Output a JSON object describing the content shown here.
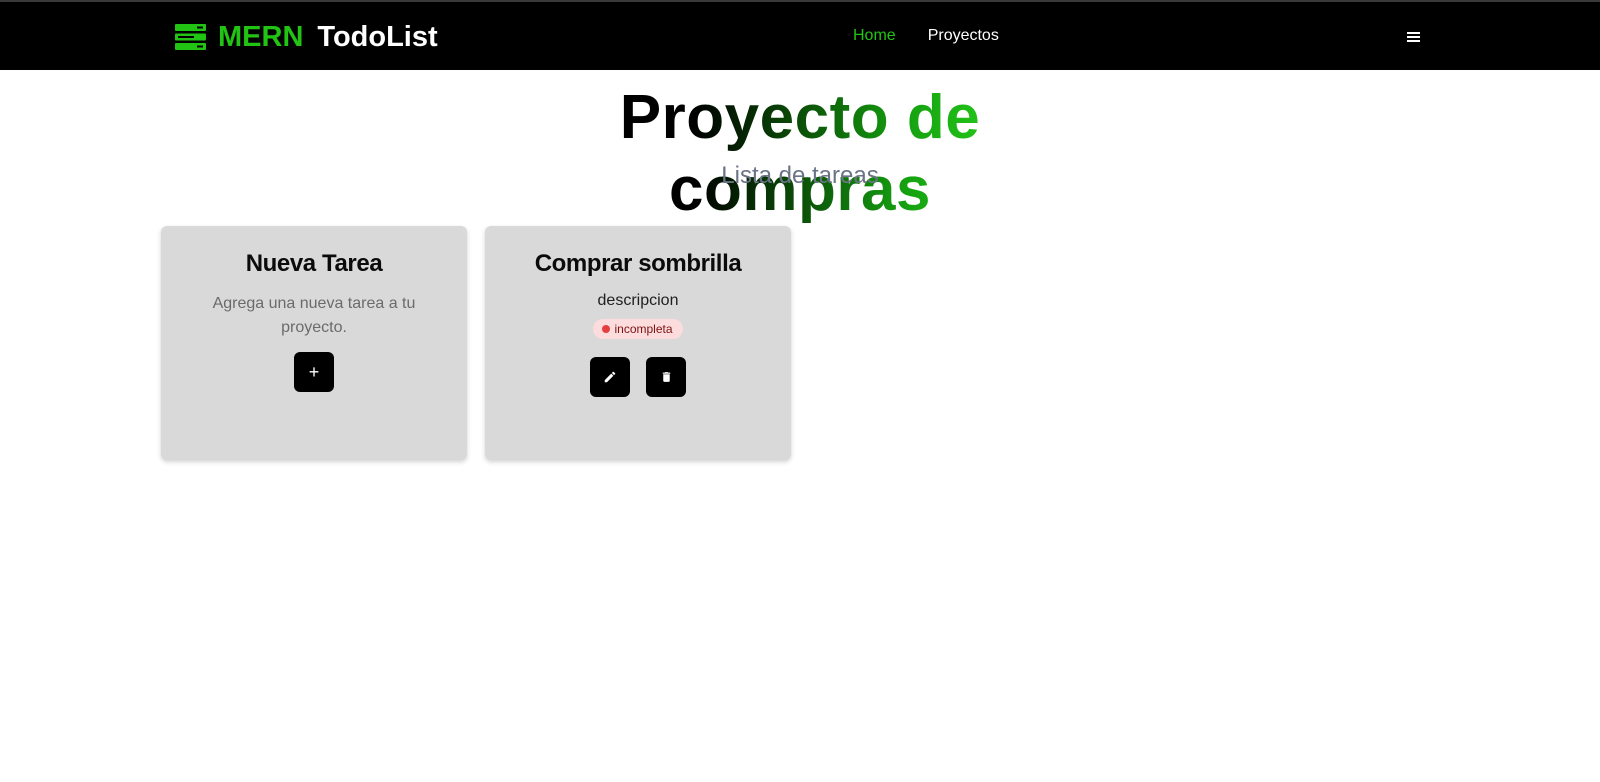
{
  "navbar": {
    "brand_accent": "MERN",
    "brand_name": "TodoList",
    "brand_icon": "server-stack-icon",
    "links": [
      {
        "label": "Home",
        "active": true
      },
      {
        "label": "Proyectos",
        "active": false
      }
    ],
    "menu_icon": "hamburger-icon"
  },
  "page": {
    "title": "Proyecto de compras",
    "subtitle": "Lista de tareas"
  },
  "cards": {
    "new_task": {
      "title": "Nueva Tarea",
      "description": "Agrega una nueva tarea a tu proyecto.",
      "add_label": "+"
    },
    "task": {
      "title": "Comprar sombrilla",
      "description": "descripcion",
      "status": "incompleta",
      "edit_icon": "pencil-icon",
      "delete_icon": "trash-icon"
    }
  },
  "colors": {
    "accent": "#22c414",
    "navbar_bg": "#000000",
    "card_bg": "#d9d9d9",
    "status_bg": "#fcdcdc",
    "status_dot": "#e53e3e",
    "subtitle": "#6b7486"
  }
}
